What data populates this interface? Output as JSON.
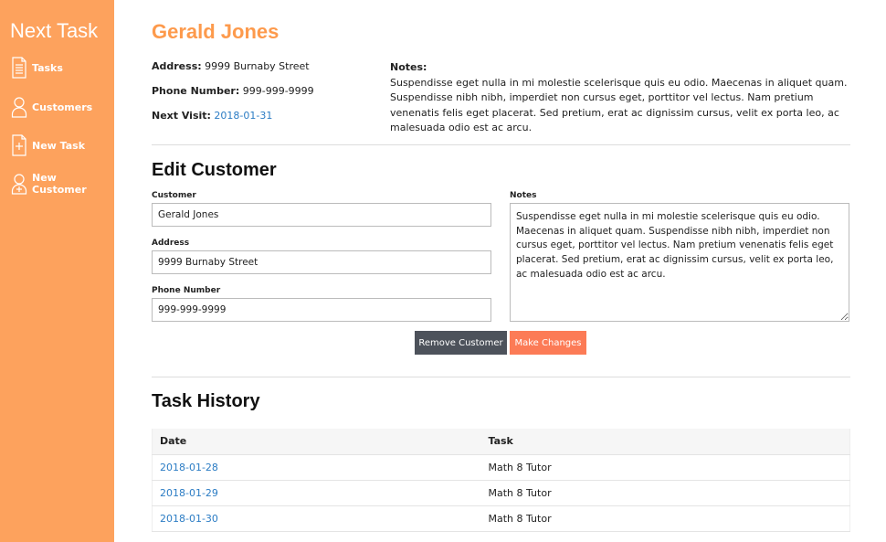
{
  "app": {
    "title": "Next Task"
  },
  "sidebar": {
    "items": [
      {
        "label": "Tasks",
        "icon": "document-icon"
      },
      {
        "label": "Customers",
        "icon": "person-icon"
      },
      {
        "label": "New Task",
        "icon": "document-plus-icon"
      },
      {
        "label": "New Customer",
        "icon": "person-plus-icon"
      }
    ]
  },
  "customer": {
    "name": "Gerald Jones",
    "address_label": "Address:",
    "address": "9999 Burnaby Street",
    "phone_label": "Phone Number:",
    "phone": "999-999-9999",
    "next_visit_label": "Next Visit:",
    "next_visit": "2018-01-31",
    "notes_label": "Notes:",
    "notes": "Suspendisse eget nulla in mi molestie scelerisque quis eu odio. Maecenas in aliquet quam. Suspendisse nibh nibh, imperdiet non cursus eget, porttitor vel lectus. Nam pretium venenatis felis eget placerat. Sed pretium, erat ac dignissim cursus, velit ex porta leo, ac malesuada odio est ac arcu."
  },
  "edit_form": {
    "heading": "Edit Customer",
    "customer_label": "Customer",
    "customer_value": "Gerald Jones",
    "address_label": "Address",
    "address_value": "9999 Burnaby Street",
    "phone_label": "Phone Number",
    "phone_value": "999-999-9999",
    "notes_label": "Notes",
    "notes_value": "Suspendisse eget nulla in mi molestie scelerisque quis eu odio. Maecenas in aliquet quam. Suspendisse nibh nibh, imperdiet non cursus eget, porttitor vel lectus. Nam pretium venenatis felis eget placerat. Sed pretium, erat ac dignissim cursus, velit ex porta leo, ac malesuada odio est ac arcu.",
    "remove_label": "Remove Customer",
    "submit_label": "Make Changes"
  },
  "history": {
    "heading": "Task History",
    "columns": [
      "Date",
      "Task"
    ],
    "rows": [
      {
        "date": "2018-01-28",
        "task": "Math 8 Tutor"
      },
      {
        "date": "2018-01-29",
        "task": "Math 8 Tutor"
      },
      {
        "date": "2018-01-30",
        "task": "Math 8 Tutor"
      }
    ]
  },
  "colors": {
    "sidebar": "#fda25d",
    "name": "#fd9a4c",
    "link": "#2b7cc4",
    "remove_button": "#4d525b",
    "submit_button": "#fc7b56"
  }
}
